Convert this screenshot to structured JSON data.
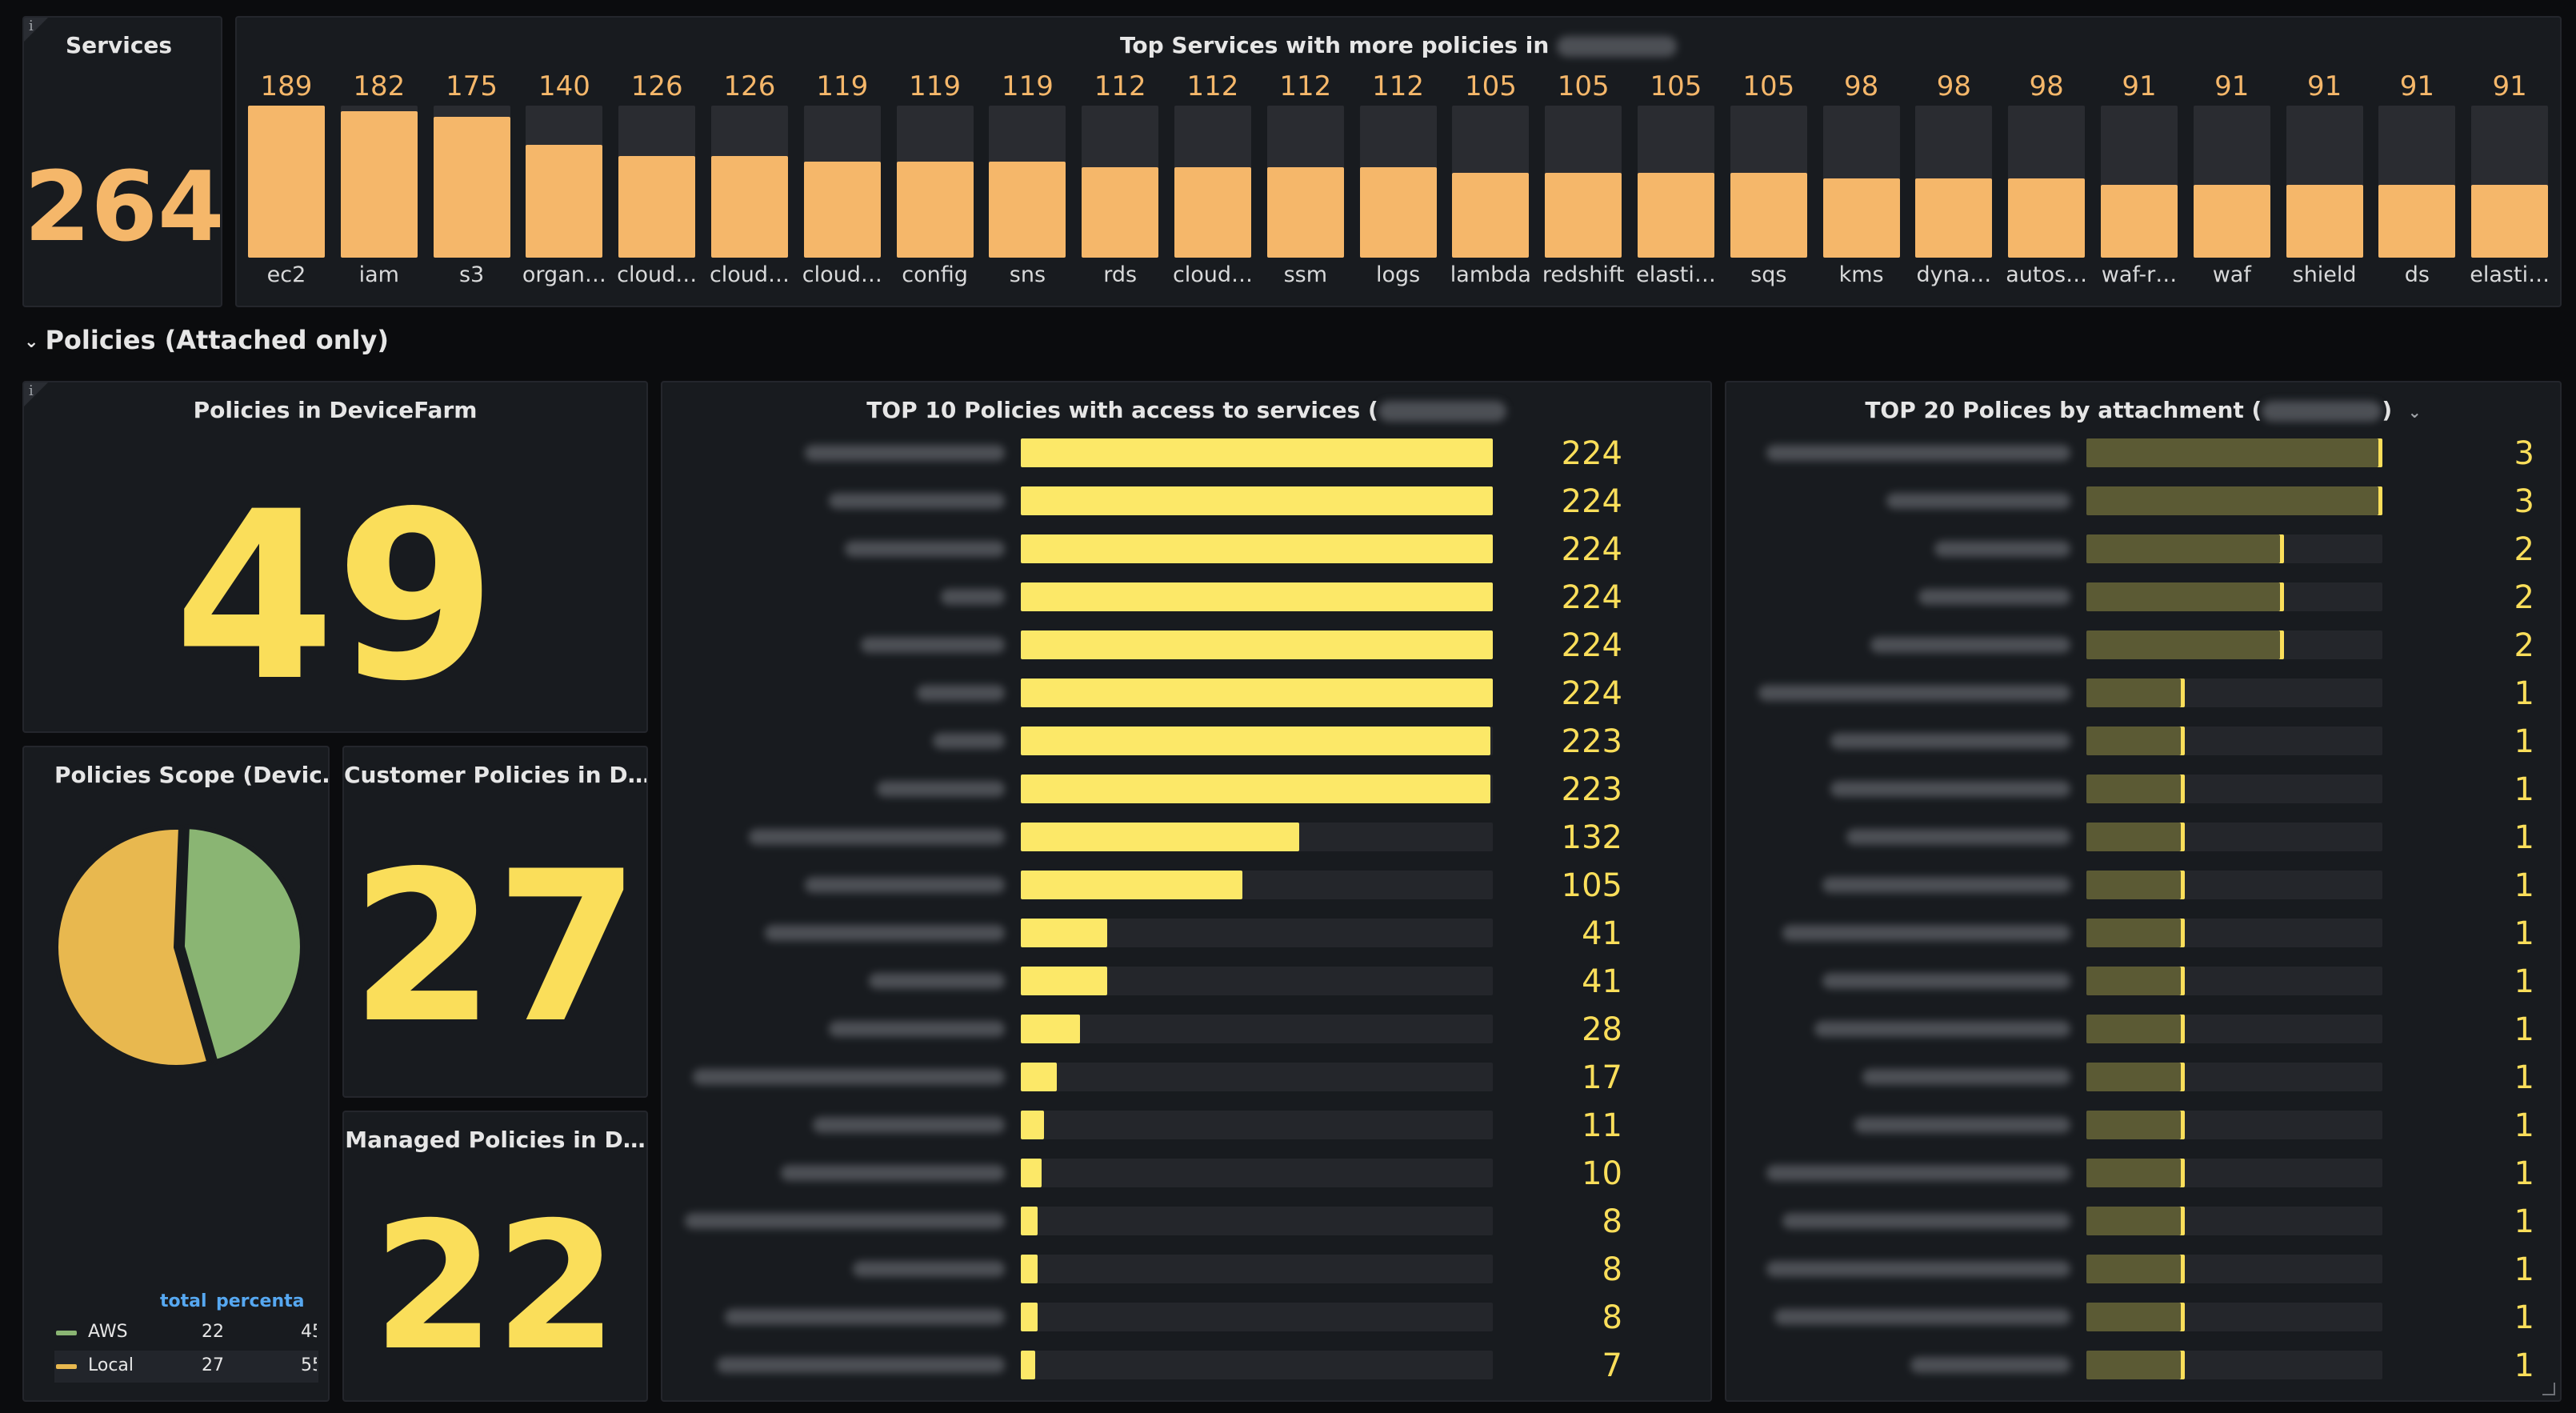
{
  "services_panel": {
    "title": "Services",
    "value": "264",
    "info_icon": "info-icon"
  },
  "top_services": {
    "title": "Top Services with more policies in",
    "bar_color": "#f5b76a",
    "track_color": "#2a2c31",
    "max": 189,
    "items": [
      {
        "label": "ec2",
        "value": 189
      },
      {
        "label": "iam",
        "value": 182
      },
      {
        "label": "s3",
        "value": 175
      },
      {
        "label": "organ…",
        "value": 140
      },
      {
        "label": "cloud…",
        "value": 126
      },
      {
        "label": "cloud…",
        "value": 126
      },
      {
        "label": "cloud…",
        "value": 119
      },
      {
        "label": "config",
        "value": 119
      },
      {
        "label": "sns",
        "value": 119
      },
      {
        "label": "rds",
        "value": 112
      },
      {
        "label": "cloud…",
        "value": 112
      },
      {
        "label": "ssm",
        "value": 112
      },
      {
        "label": "logs",
        "value": 112
      },
      {
        "label": "lambda",
        "value": 105
      },
      {
        "label": "redshift",
        "value": 105
      },
      {
        "label": "elasti…",
        "value": 105
      },
      {
        "label": "sqs",
        "value": 105
      },
      {
        "label": "kms",
        "value": 98
      },
      {
        "label": "dyna…",
        "value": 98
      },
      {
        "label": "autos…",
        "value": 98
      },
      {
        "label": "waf-r…",
        "value": 91
      },
      {
        "label": "waf",
        "value": 91
      },
      {
        "label": "shield",
        "value": 91
      },
      {
        "label": "ds",
        "value": 91
      },
      {
        "label": "elasti…",
        "value": 91
      }
    ]
  },
  "row": {
    "title": "Policies (Attached only)",
    "chevron_icon": "chevron-down-icon"
  },
  "policies_devicefarm": {
    "title": "Policies in DeviceFarm",
    "value": "49",
    "color": "#fade5a"
  },
  "policies_scope": {
    "title": "Policies Scope (Devic…",
    "legend_headers": [
      "total",
      "percenta"
    ],
    "slices": [
      {
        "name": "AWS",
        "total": "22",
        "percent": "45",
        "value": 22,
        "color": "#8ab573"
      },
      {
        "name": "Local",
        "total": "27",
        "percent": "55",
        "value": 27,
        "color": "#e8b84f"
      }
    ]
  },
  "customer_policies": {
    "title": "Customer Policies in D…",
    "value": "27",
    "color": "#fade5a"
  },
  "managed_policies": {
    "title": "Managed Policies in D…",
    "value": "22",
    "color": "#fade5a"
  },
  "top10_policies": {
    "title": "TOP 10 Policies with access to services (",
    "bar_color": "#fce868",
    "value_color": "#fade5a",
    "max": 224,
    "rows": [
      224,
      224,
      224,
      224,
      224,
      224,
      223,
      223,
      132,
      105,
      41,
      41,
      28,
      17,
      11,
      10,
      8,
      8,
      8,
      7
    ]
  },
  "top20_policies": {
    "title": "TOP 20 Polices by attachment (",
    "title_suffix": ")",
    "bar_color": "#5b5a34",
    "bar_edge_color": "#fade5a",
    "value_color": "#fade5a",
    "max": 3,
    "rows": [
      3,
      3,
      2,
      2,
      2,
      1,
      1,
      1,
      1,
      1,
      1,
      1,
      1,
      1,
      1,
      1,
      1,
      1,
      1,
      1
    ]
  }
}
